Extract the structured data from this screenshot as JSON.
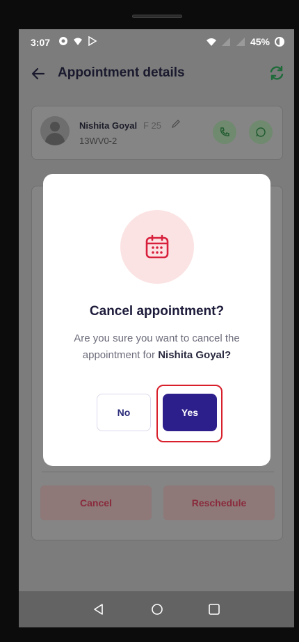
{
  "status_bar": {
    "time": "3:07",
    "battery": "45%"
  },
  "app_bar": {
    "title": "Appointment details"
  },
  "patient": {
    "name": "Nishita Goyal",
    "meta": "F 25",
    "id": "13WV0-2"
  },
  "actions": {
    "cancel_label": "Cancel",
    "reschedule_label": "Reschedule"
  },
  "dialog": {
    "title": "Cancel appointment?",
    "message_prefix": "Are you sure you want to cancel the appointment for",
    "message_name": "Nishita Goyal?",
    "no_label": "No",
    "yes_label": "Yes"
  },
  "colors": {
    "primary": "#2c1f8c",
    "danger": "#d8202c",
    "icon_bg": "#fbe3e3",
    "refresh": "#2eaf5a"
  },
  "icons": [
    "back-arrow-icon",
    "refresh-icon",
    "edit-icon",
    "phone-icon",
    "whatsapp-icon",
    "calendar-icon"
  ]
}
